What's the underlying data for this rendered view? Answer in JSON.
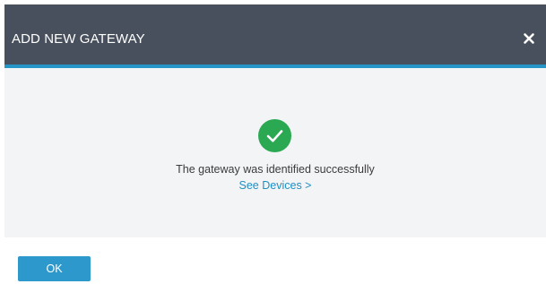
{
  "dialog": {
    "title": "ADD NEW GATEWAY",
    "close_icon": "close-icon",
    "success_icon": "checkmark-circle-icon",
    "message": "The gateway was identified successfully",
    "link_label": "See Devices >",
    "ok_label": "OK"
  },
  "colors": {
    "header_bg": "#48505d",
    "accent": "#2596c6",
    "success": "#2aa952",
    "link": "#1f8fc2",
    "button": "#2d98cc"
  }
}
